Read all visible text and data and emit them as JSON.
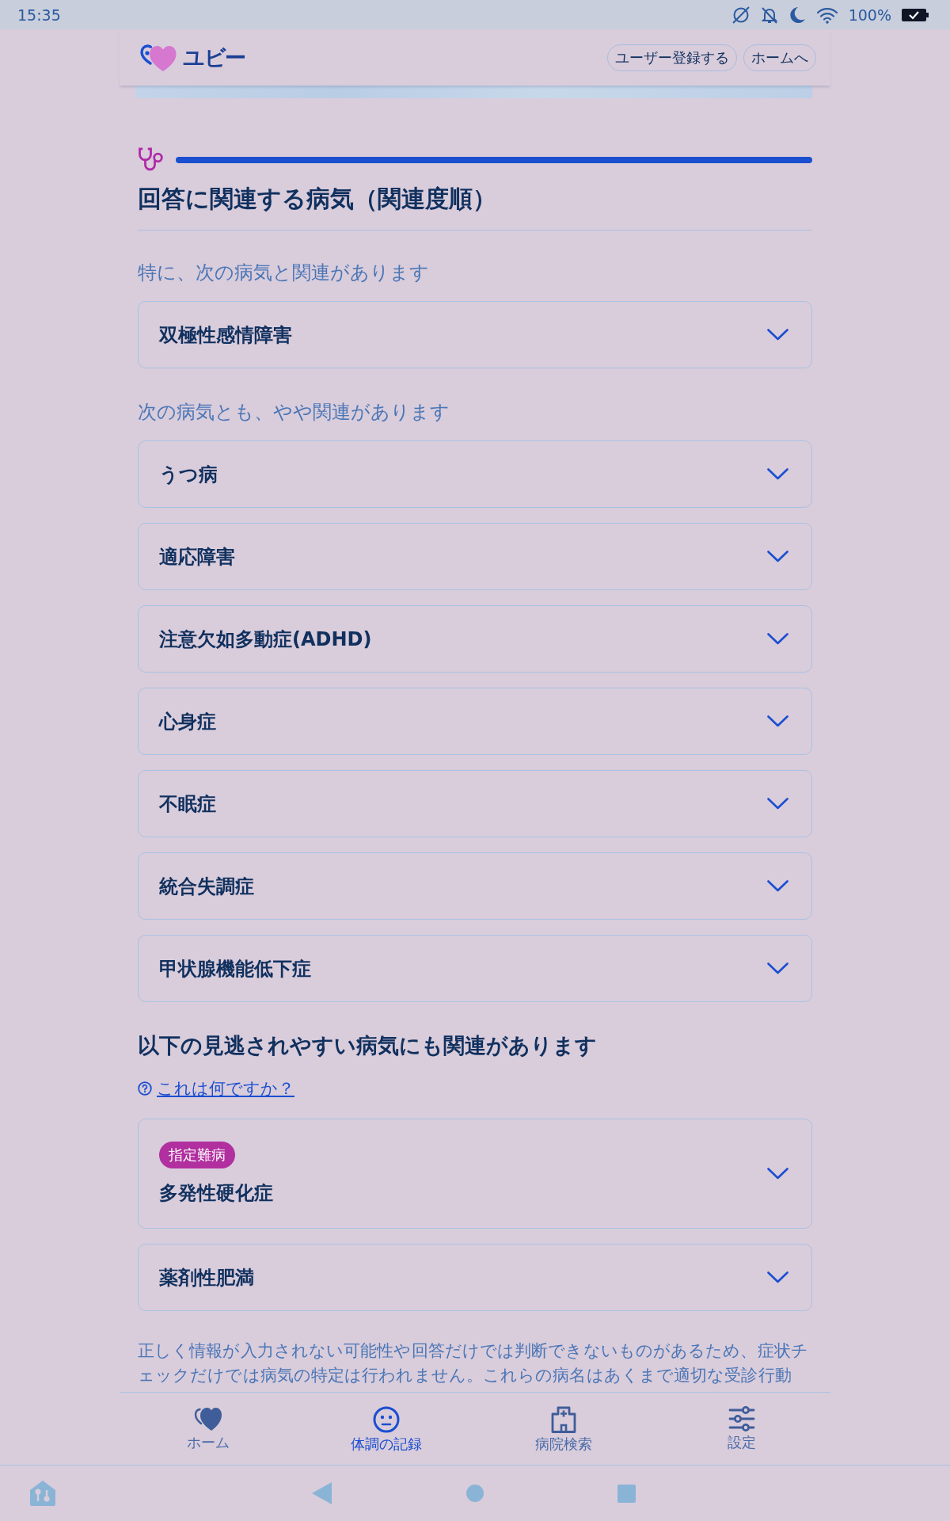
{
  "status_bar": {
    "time": "15:35",
    "battery": "100%"
  },
  "header": {
    "logo": "ユビー",
    "buttons": [
      "ユーザー登録する",
      "ホームへ"
    ]
  },
  "results": {
    "title": "回答に関連する病気（関連度順）",
    "groups": [
      {
        "label": "特に、次の病気と関連があります",
        "diseases": [
          {
            "name": "双極性感情障害",
            "expanded": false
          }
        ]
      },
      {
        "label": "次の病気とも、やや関連があります",
        "diseases": [
          {
            "name": "うつ病",
            "expanded": false
          },
          {
            "name": "適応障害",
            "expanded": false
          },
          {
            "name": "注意欠如多動症(ADHD)",
            "expanded": false
          },
          {
            "name": "心身症",
            "expanded": false
          },
          {
            "name": "不眠症",
            "expanded": false
          },
          {
            "name": "統合失調症",
            "expanded": false
          },
          {
            "name": "甲状腺機能低下症",
            "expanded": false
          }
        ]
      }
    ]
  },
  "overlooked": {
    "heading": "以下の見逃されやすい病気にも関連があります",
    "help_link": "これは何ですか？",
    "diseases": [
      {
        "tag": "指定難病",
        "name": "多発性硬化症",
        "expanded": false
      },
      {
        "name": "薬剤性肥満",
        "expanded": false
      }
    ]
  },
  "disclaimer": "正しく情報が入力されない可能性や回答だけでは判断できないものがあるため、症状チェックだけでは病気の特定は行われません。これらの病名はあくまで適切な受診行動",
  "bottom_nav": {
    "items": [
      {
        "label": "ホーム",
        "selected": false
      },
      {
        "label": "体調の記録",
        "selected": true
      },
      {
        "label": "病院検索",
        "selected": false
      },
      {
        "label": "設定",
        "selected": false
      }
    ]
  }
}
